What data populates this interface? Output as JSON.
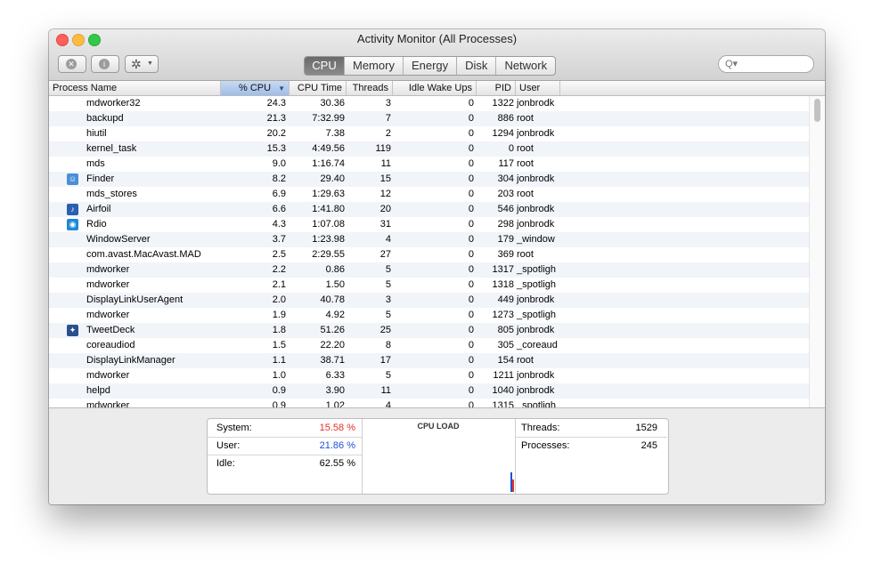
{
  "window": {
    "title": "Activity Monitor (All Processes)"
  },
  "toolbar": {
    "stop_icon": "stop-process-icon",
    "info_icon": "info-icon",
    "gear_icon": "gear-icon",
    "search_placeholder": "Q▾"
  },
  "tabs": [
    {
      "label": "CPU",
      "active": true
    },
    {
      "label": "Memory",
      "active": false
    },
    {
      "label": "Energy",
      "active": false
    },
    {
      "label": "Disk",
      "active": false
    },
    {
      "label": "Network",
      "active": false
    }
  ],
  "columns": {
    "name": "Process Name",
    "cpu": "% CPU",
    "time": "CPU Time",
    "threads": "Threads",
    "idle": "Idle Wake Ups",
    "pid": "PID",
    "user": "User"
  },
  "processes": [
    {
      "name": "mdworker32",
      "cpu": "24.3",
      "time": "30.36",
      "threads": "3",
      "idle": "0",
      "pid": "1322",
      "user": "jonbrodk",
      "icon": ""
    },
    {
      "name": "backupd",
      "cpu": "21.3",
      "time": "7:32.99",
      "threads": "7",
      "idle": "0",
      "pid": "886",
      "user": "root",
      "icon": ""
    },
    {
      "name": "hiutil",
      "cpu": "20.2",
      "time": "7.38",
      "threads": "2",
      "idle": "0",
      "pid": "1294",
      "user": "jonbrodk",
      "icon": ""
    },
    {
      "name": "kernel_task",
      "cpu": "15.3",
      "time": "4:49.56",
      "threads": "119",
      "idle": "0",
      "pid": "0",
      "user": "root",
      "icon": ""
    },
    {
      "name": "mds",
      "cpu": "9.0",
      "time": "1:16.74",
      "threads": "11",
      "idle": "0",
      "pid": "117",
      "user": "root",
      "icon": ""
    },
    {
      "name": "Finder",
      "cpu": "8.2",
      "time": "29.40",
      "threads": "15",
      "idle": "0",
      "pid": "304",
      "user": "jonbrodk",
      "icon": "finder-icon"
    },
    {
      "name": "mds_stores",
      "cpu": "6.9",
      "time": "1:29.63",
      "threads": "12",
      "idle": "0",
      "pid": "203",
      "user": "root",
      "icon": ""
    },
    {
      "name": "Airfoil",
      "cpu": "6.6",
      "time": "1:41.80",
      "threads": "20",
      "idle": "0",
      "pid": "546",
      "user": "jonbrodk",
      "icon": "airfoil-icon"
    },
    {
      "name": "Rdio",
      "cpu": "4.3",
      "time": "1:07.08",
      "threads": "31",
      "idle": "0",
      "pid": "298",
      "user": "jonbrodk",
      "icon": "rdio-icon"
    },
    {
      "name": "WindowServer",
      "cpu": "3.7",
      "time": "1:23.98",
      "threads": "4",
      "idle": "0",
      "pid": "179",
      "user": "_window",
      "icon": ""
    },
    {
      "name": "com.avast.MacAvast.MAD",
      "cpu": "2.5",
      "time": "2:29.55",
      "threads": "27",
      "idle": "0",
      "pid": "369",
      "user": "root",
      "icon": ""
    },
    {
      "name": "mdworker",
      "cpu": "2.2",
      "time": "0.86",
      "threads": "5",
      "idle": "0",
      "pid": "1317",
      "user": "_spotligh",
      "icon": ""
    },
    {
      "name": "mdworker",
      "cpu": "2.1",
      "time": "1.50",
      "threads": "5",
      "idle": "0",
      "pid": "1318",
      "user": "_spotligh",
      "icon": ""
    },
    {
      "name": "DisplayLinkUserAgent",
      "cpu": "2.0",
      "time": "40.78",
      "threads": "3",
      "idle": "0",
      "pid": "449",
      "user": "jonbrodk",
      "icon": ""
    },
    {
      "name": "mdworker",
      "cpu": "1.9",
      "time": "4.92",
      "threads": "5",
      "idle": "0",
      "pid": "1273",
      "user": "_spotligh",
      "icon": ""
    },
    {
      "name": "TweetDeck",
      "cpu": "1.8",
      "time": "51.26",
      "threads": "25",
      "idle": "0",
      "pid": "805",
      "user": "jonbrodk",
      "icon": "tweetdeck-icon"
    },
    {
      "name": "coreaudiod",
      "cpu": "1.5",
      "time": "22.20",
      "threads": "8",
      "idle": "0",
      "pid": "305",
      "user": "_coreaud",
      "icon": ""
    },
    {
      "name": "DisplayLinkManager",
      "cpu": "1.1",
      "time": "38.71",
      "threads": "17",
      "idle": "0",
      "pid": "154",
      "user": "root",
      "icon": ""
    },
    {
      "name": "mdworker",
      "cpu": "1.0",
      "time": "6.33",
      "threads": "5",
      "idle": "0",
      "pid": "1211",
      "user": "jonbrodk",
      "icon": ""
    },
    {
      "name": "helpd",
      "cpu": "0.9",
      "time": "3.90",
      "threads": "11",
      "idle": "0",
      "pid": "1040",
      "user": "jonbrodk",
      "icon": ""
    },
    {
      "name": "mdworker",
      "cpu": "0.9",
      "time": "1.02",
      "threads": "4",
      "idle": "0",
      "pid": "1315",
      "user": "_spotligh",
      "icon": ""
    }
  ],
  "summary": {
    "system_label": "System:",
    "system_value": "15.58 %",
    "user_label": "User:",
    "user_value": "21.86 %",
    "idle_label": "Idle:",
    "idle_value": "62.55 %",
    "cpu_load_label": "CPU LOAD",
    "threads_label": "Threads:",
    "threads_value": "1529",
    "processes_label": "Processes:",
    "processes_value": "245"
  },
  "colors": {
    "system": "#e0312d",
    "user": "#1f4fd6",
    "finder_icon": "#4a8fd8",
    "airfoil_icon": "#2b5fb0",
    "rdio_icon": "#1e88d6",
    "tweetdeck_icon": "#2a4f8e"
  }
}
